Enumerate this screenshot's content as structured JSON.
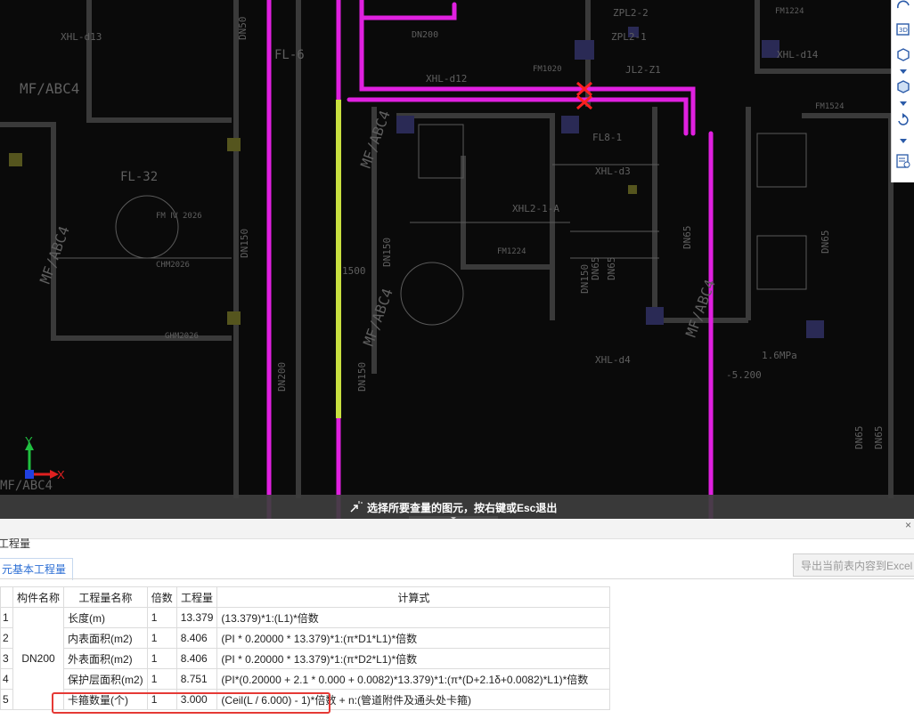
{
  "cad": {
    "labels": {
      "xhl_d13": "XHL-d13",
      "xhl_d12": "XHL-d12",
      "xhl_d14": "XHL-d14",
      "xhl_d4": "XHL-d4",
      "xhl_d3": "XHL-d3",
      "xhl_2_1_a": "XHL2-1-A",
      "fl_6": "FL-6",
      "fl_32": "FL-32",
      "fl_8_1": "FL8-1",
      "zpl_2_2": "ZPL2-2",
      "zpl_2_1": "ZPL2-1",
      "jl_2_z1": "JL2-Z1",
      "mf_abc4_a": "MF/ABC4",
      "mf_abc4_b": "MF/ABC4",
      "mf_abc4_c": "MF/ABC4",
      "mf_abc4_d": "MF/ABC4",
      "mf_abc4_e": "MF/ABC4",
      "mf_abc4_f": "MF/ABC4",
      "dn200_a": "DN200",
      "dn150_a": "DN150",
      "dn150_b": "DN150",
      "dn150_c": "DN150",
      "dn150_d": "DN150",
      "dn65_a": "DN65",
      "dn65_b": "DN65",
      "dn65_c": "DN65",
      "dn65_d": "DN65",
      "dn65_e": "DN65",
      "dn65_f": "DN65",
      "dn50": "DN50",
      "fm1020": "FM1020",
      "fm1224_a": "FM1224",
      "fm1224_b": "FM1224",
      "fm1524": "FM1524",
      "chm2026": "CHM2026",
      "ghm2026": "GHM2026",
      "fm2026": "FM Ⅳ 2026",
      "dn200_b": "DN200",
      "elev": "-5.200",
      "press": "1.6MPa",
      "dim_1500": "1500"
    },
    "axis": {
      "x": "X",
      "y": "Y"
    }
  },
  "toolbar": {
    "icons": [
      "orbit-icon",
      "3d-view-icon",
      "cube-icon",
      "cube-shaded-icon",
      "rotate-icon",
      "properties-icon"
    ]
  },
  "hint": {
    "text": "选择所要查量的图元，按右键或Esc退出"
  },
  "panel": {
    "title": "工程量",
    "close": "×",
    "tab": "元基本工程量",
    "export_label": "导出当前表内容到Excel",
    "columns": [
      "构件名称",
      "工程量名称",
      "倍数",
      "工程量",
      "计算式"
    ],
    "component_name": "DN200",
    "rows": [
      {
        "no": "1",
        "name": "长度(m)",
        "mult": "1",
        "qty": "13.379",
        "formula": "(13.379)*1:(L1)*倍数"
      },
      {
        "no": "2",
        "name": "内表面积(m2)",
        "mult": "1",
        "qty": "8.406",
        "formula": "(PI * 0.20000 * 13.379)*1:(π*D1*L1)*倍数"
      },
      {
        "no": "3",
        "name": "外表面积(m2)",
        "mult": "1",
        "qty": "8.406",
        "formula": "(PI * 0.20000 * 13.379)*1:(π*D2*L1)*倍数"
      },
      {
        "no": "4",
        "name": "保护层面积(m2)",
        "mult": "1",
        "qty": "8.751",
        "formula": "(PI*(0.20000 + 2.1 * 0.000 + 0.0082)*13.379)*1:(π*(D+2.1δ+0.0082)*L1)*倍数"
      },
      {
        "no": "5",
        "name": "卡箍数量(个)",
        "mult": "1",
        "qty": "3.000",
        "formula": "(Ceil(L / 6.000) - 1)*倍数 + n:(管道附件及通头处卡箍)"
      }
    ]
  },
  "colors": {
    "pipe_magenta": "#e020e0",
    "pipe_selected": "#c8e040",
    "accent_blue": "#2b6ed4",
    "highlight_red": "#e53935"
  }
}
